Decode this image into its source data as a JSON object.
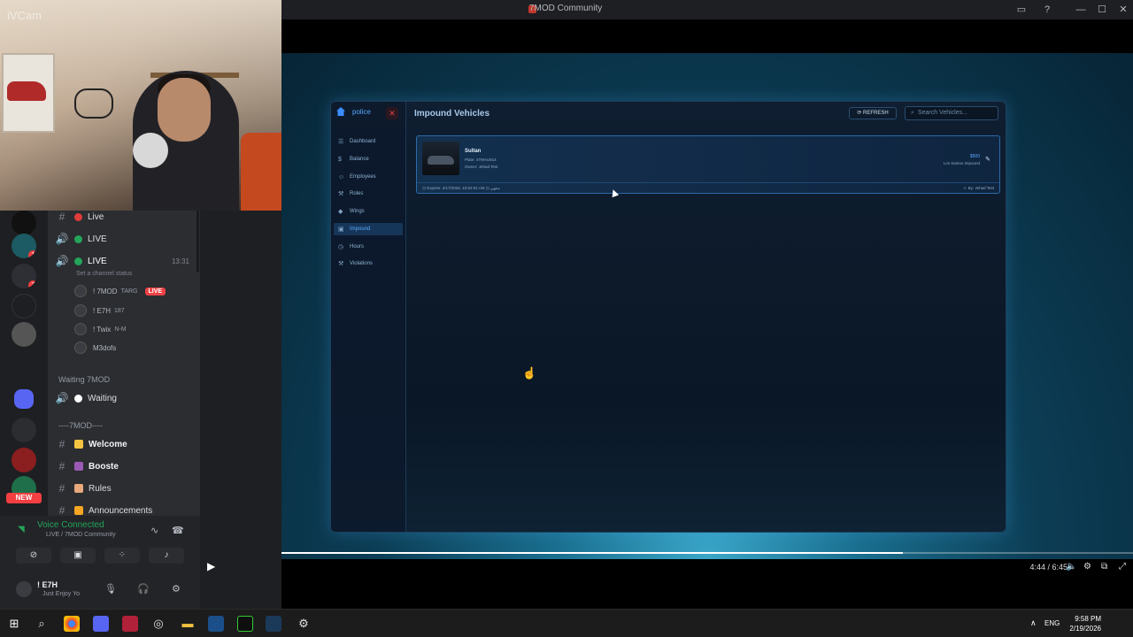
{
  "window": {
    "title": "7MOD Community"
  },
  "webcam": {
    "overlay_label": "iVCam"
  },
  "servers": [
    {
      "name": "server-1",
      "badge": ""
    },
    {
      "name": "server-2",
      "badge": "1"
    },
    {
      "name": "server-3",
      "badge": "2"
    },
    {
      "name": "server-4",
      "badge": ""
    },
    {
      "name": "server-5",
      "badge": ""
    },
    {
      "name": "server-6",
      "badge": ""
    },
    {
      "name": "server-7",
      "badge": ""
    },
    {
      "name": "server-8",
      "badge": ""
    },
    {
      "name": "server-9",
      "badge": ""
    },
    {
      "name": "server-10",
      "badge": ""
    }
  ],
  "server_new_label": "NEW",
  "channels": {
    "items": [
      {
        "prefix": "#",
        "label": "Live",
        "dot": "#e03c3c"
      },
      {
        "prefix": "🔊",
        "label": "LIVE",
        "dot": "#23a55a"
      },
      {
        "prefix": "🔊",
        "label": "LIVE",
        "dot": "#23a55a",
        "time": "13:31"
      }
    ],
    "status_hint": "Set a channel status",
    "members": [
      {
        "name": "! 7MOD",
        "tag": "TARG",
        "live": "LIVE"
      },
      {
        "name": "! E7H",
        "tag": "187",
        "live": ""
      },
      {
        "name": "! Twix",
        "tag": "N-M",
        "live": ""
      },
      {
        "name": "M3dofs",
        "tag": "",
        "live": ""
      }
    ],
    "category_waiting": "Waiting 7MOD",
    "waiting_channel": "Waiting",
    "category_main": "----7MOD----",
    "text_channels": [
      {
        "label": "Welcome",
        "emoji_color": "#f5c542"
      },
      {
        "label": "Booste",
        "emoji_color": "#9b59b6"
      },
      {
        "label": "Rules",
        "emoji_color": "#e8a87c"
      },
      {
        "label": "Announcements",
        "emoji_color": "#f5a623"
      }
    ]
  },
  "voice": {
    "title": "Voice Connected",
    "subtitle": "LIVE / 7MOD Community",
    "user_name": "! E7H",
    "user_status": "Just Enjoy Yo"
  },
  "panel": {
    "brand": "police",
    "close_label": "✕",
    "title": "Impound Vehicles",
    "refresh_label": "REFRESH",
    "search_placeholder": "Search Vehicles...",
    "nav": [
      {
        "icon": "☰",
        "label": "Dashboard",
        "selected": false
      },
      {
        "icon": "$",
        "label": "Balance",
        "selected": false
      },
      {
        "icon": "☺",
        "label": "Employees",
        "selected": false
      },
      {
        "icon": "⚒",
        "label": "Roles",
        "selected": false
      },
      {
        "icon": "◆",
        "label": "Wings",
        "selected": false
      },
      {
        "icon": "▣",
        "label": "Impound",
        "selected": true
      },
      {
        "icon": "◷",
        "label": "Hours",
        "selected": false
      },
      {
        "icon": "⚒",
        "label": "Violations",
        "selected": false
      }
    ],
    "vehicle": {
      "name": "Sultan",
      "plate": "Plate: 47WAU914",
      "owner": "Owner: Jehad Test",
      "price": "$500",
      "lot": "Los Santos Impound",
      "expires": "Expires: 2/17/2026, 10:52:01 AM",
      "remaining": "منتهي",
      "by": "By: Jehad Test"
    }
  },
  "player": {
    "time": "4:44 / 6:45",
    "progress": 0.73
  },
  "taskbar": {
    "lang": "ENG",
    "time": "9:58 PM",
    "date": "2/19/2026"
  },
  "colors": {
    "accent": "#5aa8ff",
    "discord_green": "#23a55a",
    "live_red": "#ed4245"
  }
}
